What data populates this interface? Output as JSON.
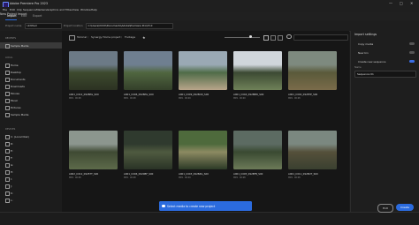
{
  "window": {
    "title": "Adobe Premiere Pro 2023"
  },
  "menu": [
    "File",
    "Edit",
    "Clip",
    "Sequence",
    "Markers",
    "Graphics and Titles",
    "View",
    "Window",
    "Help"
  ],
  "tabs": [
    {
      "label": "Import",
      "active": true
    },
    {
      "label": "Edit",
      "active": false
    },
    {
      "label": "Export",
      "active": false
    }
  ],
  "project_header": "New Project Import",
  "project": {
    "name_label": "Project name",
    "name_value": "Untitled",
    "location_label": "Project location",
    "location_value": "C:\\Users\\XXXX\\Documents\\Adobe\\Premiere Pro\\23.0"
  },
  "sidebar": {
    "recents_label": "RECENTS",
    "recents": [
      {
        "label": "Sample Media",
        "selected": true
      }
    ],
    "local_label": "LOCAL",
    "local": [
      "Home",
      "Desktop",
      "Documents",
      "Downloads",
      "Movies",
      "Music",
      "Pictures",
      "Sample Media"
    ],
    "devices_label": "DEVICES",
    "devices": [
      "C: (Local Disk)",
      "D:",
      "E:",
      "F:",
      "G:",
      "H:",
      "I:",
      "J:",
      "K:",
      "L:"
    ]
  },
  "breadcrumb": [
    "Tutorial",
    "Synergy Home project",
    "Footage"
  ],
  "media": [
    {
      "name": "A001_C012_0928PG_S00",
      "meta": "MP4 · 00:08",
      "palette": [
        "#6c7a86",
        "#3d4a2e",
        "#2c3222"
      ]
    },
    {
      "name": "A001_C006_0928PG_S00",
      "meta": "MP4 · 00:08",
      "palette": [
        "#6f7f90",
        "#506640",
        "#34402a"
      ]
    },
    {
      "name": "A001_C009_0928OD_S00",
      "meta": "MP4 · 00:09",
      "palette": [
        "#9aa9b4",
        "#4f6c48",
        "#b8a58a"
      ]
    },
    {
      "name": "A001_C004_0928BW_S00",
      "meta": "MP4 · 00:09",
      "palette": [
        "#d0d6db",
        "#3c4a33",
        "#6f8158"
      ]
    },
    {
      "name": "A001_C002_0928TP_S00",
      "meta": "MP4 · 00:08",
      "palette": [
        "#7e8a7f",
        "#5a5a3a",
        "#7a6b4a"
      ]
    },
    {
      "name": "A002_C012_0925TT_S00",
      "meta": "MP4 · 00:08",
      "palette": [
        "#8c968e",
        "#3f4a33",
        "#5d6a4a"
      ]
    },
    {
      "name": "A001_C006_0920BF_S00",
      "meta": "MP4 · 00:08",
      "palette": [
        "#2f3a2e",
        "#4f5a40",
        "#2a3326"
      ]
    },
    {
      "name": "A001_C003_0928ZG_S00",
      "meta": "MP4 · 00:09",
      "palette": [
        "#4e6a3c",
        "#8c8a62",
        "#2c3a26"
      ]
    },
    {
      "name": "A001_C005_0928FB_S00",
      "meta": "MP4 · 00:08",
      "palette": [
        "#5c6b62",
        "#3a4a32",
        "#6c7a58"
      ]
    },
    {
      "name": "A001_C011_0928OT_S00",
      "meta": "MP4 · 00:08",
      "palette": [
        "#7b8880",
        "#55503a",
        "#3a4030"
      ]
    }
  ],
  "import_settings": {
    "title": "Import settings",
    "options": [
      {
        "label": "Copy media",
        "on": false
      },
      {
        "label": "New bin",
        "on": false
      },
      {
        "label": "Create new sequence",
        "on": true
      }
    ],
    "name_label": "Name",
    "sequence_name": "Sequence 01"
  },
  "toast": "Select media to create new project",
  "footer": {
    "exit_label": "Exit",
    "create_label": "Create"
  },
  "colors": {
    "accent": "#2b6bde",
    "toggle_on": "#3b6ee6"
  },
  "icons": [
    "app-icon",
    "search-icon",
    "close-icon",
    "minimize-icon",
    "maximize-icon",
    "folder-icon",
    "star-icon",
    "gear-icon",
    "info-icon"
  ]
}
